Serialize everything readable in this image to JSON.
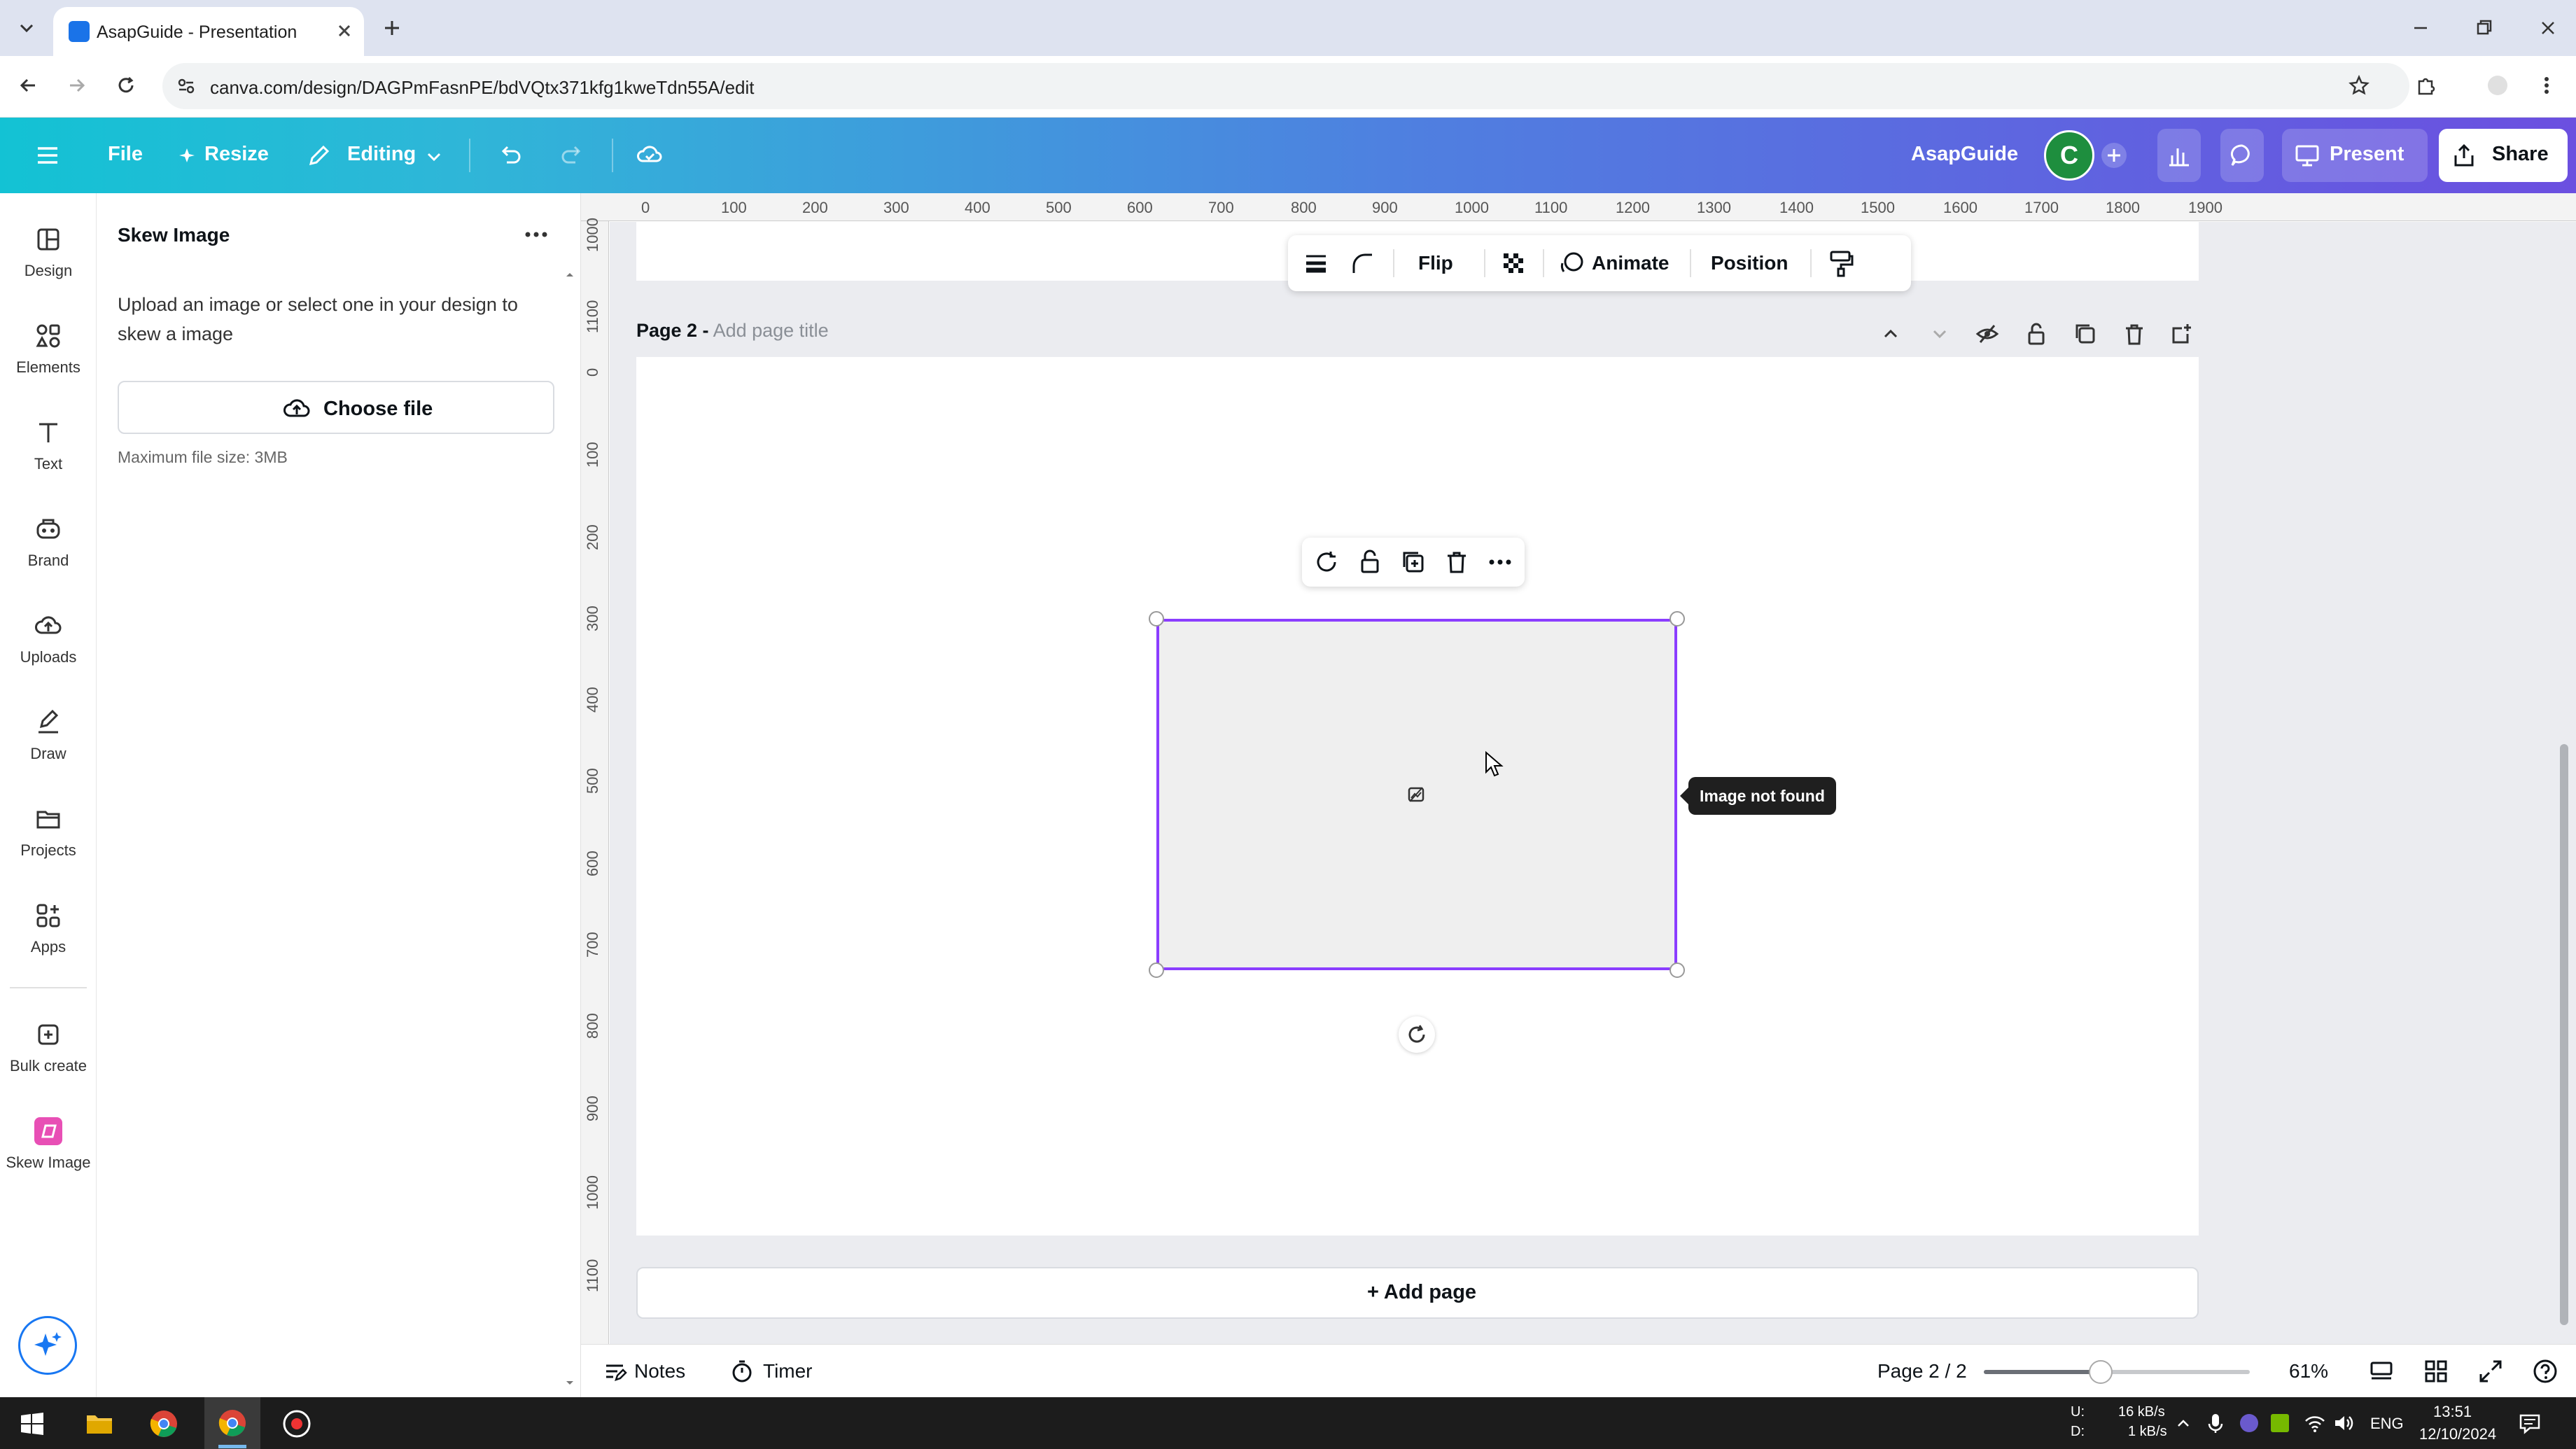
{
  "browser": {
    "tab_title": "AsapGuide - Presentation",
    "url": "canva.com/design/DAGPmFasnPE/bdVQtx371kfg1kweTdn55A/edit"
  },
  "header": {
    "file": "File",
    "resize": "Resize",
    "editing": "Editing",
    "team": "AsapGuide",
    "avatar_initial": "C",
    "present": "Present",
    "share": "Share"
  },
  "rail": {
    "items": [
      {
        "label": "Design",
        "icon": "design-icon"
      },
      {
        "label": "Elements",
        "icon": "elements-icon"
      },
      {
        "label": "Text",
        "icon": "text-icon"
      },
      {
        "label": "Brand",
        "icon": "brand-icon"
      },
      {
        "label": "Uploads",
        "icon": "uploads-icon"
      },
      {
        "label": "Draw",
        "icon": "draw-icon"
      },
      {
        "label": "Projects",
        "icon": "projects-icon"
      },
      {
        "label": "Apps",
        "icon": "apps-icon"
      },
      {
        "label": "Bulk create",
        "icon": "bulk-create-icon"
      },
      {
        "label": "Skew Image",
        "icon": "skew-image-icon"
      }
    ]
  },
  "panel": {
    "title": "Skew Image",
    "description": "Upload an image or select one in your design to skew a image",
    "choose_file": "Choose file",
    "max_size": "Maximum file size: 3MB"
  },
  "ruler": {
    "top": [
      "0",
      "100",
      "200",
      "300",
      "400",
      "500",
      "600",
      "700",
      "800",
      "900",
      "1000",
      "1100",
      "1200",
      "1300",
      "1400",
      "1500",
      "1600",
      "1700",
      "1800",
      "1900"
    ],
    "left_prev": [
      "1000",
      "1100"
    ],
    "left": [
      "0",
      "100",
      "200",
      "300",
      "400",
      "500",
      "600",
      "700",
      "800",
      "900",
      "1000",
      "1100"
    ]
  },
  "context_toolbar": {
    "flip": "Flip",
    "animate": "Animate",
    "position": "Position"
  },
  "page": {
    "label": "Page 2 -",
    "title_placeholder": "Add page title",
    "add_page": "+ Add page"
  },
  "image": {
    "tooltip": "Image not found"
  },
  "footer": {
    "notes": "Notes",
    "timer": "Timer",
    "page_indicator": "Page 2 / 2",
    "zoom_percent": 61,
    "zoom": "61%"
  },
  "taskbar": {
    "net_up_label": "U:",
    "net_down_label": "D:",
    "net_up": "16 kB/s",
    "net_down": "1 kB/s",
    "lang": "ENG",
    "time": "13:51",
    "date": "12/10/2024"
  },
  "colors": {
    "accent": "#8b3dff",
    "header_start": "#13c2d4",
    "header_end": "#6b4fe0",
    "avatar": "#1e8e3e"
  }
}
